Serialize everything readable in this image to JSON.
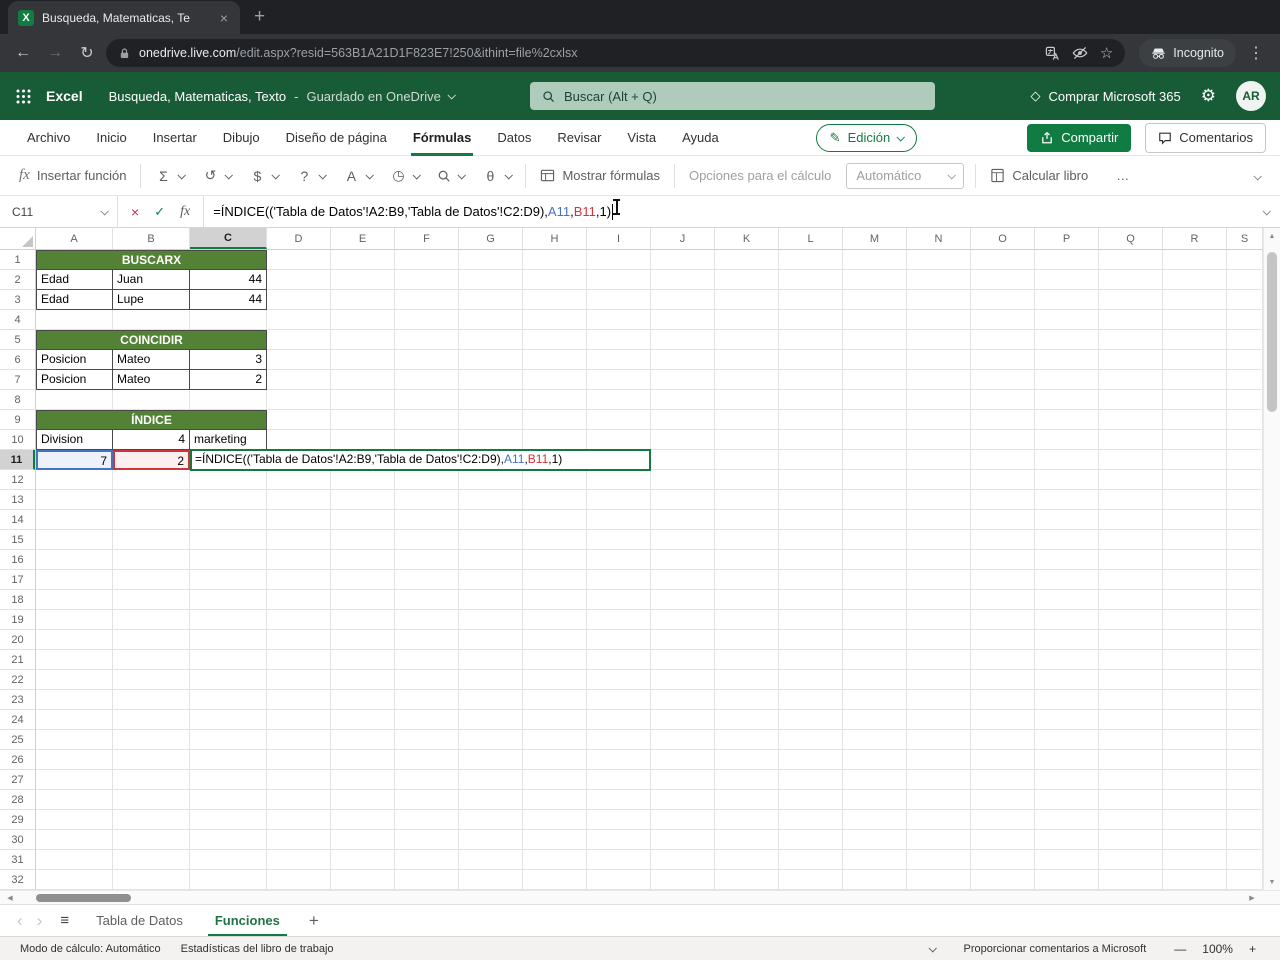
{
  "browser": {
    "tab": {
      "title": "Busqueda, Matematicas, Te"
    },
    "address": {
      "url_domain": "onedrive.live.com",
      "url_path": "/edit.aspx?resid=563B1A21D1F823E7!250&ithint=file%2cxlsx"
    },
    "incognito_label": "Incognito"
  },
  "suite_header": {
    "app_name": "Excel",
    "doc_title": "Busqueda, Matematicas, Texto",
    "title_separator": "-",
    "save_status": "Guardado en OneDrive",
    "search_placeholder": "Buscar (Alt + Q)",
    "upgrade_label": "Comprar Microsoft 365",
    "avatar_initials": "AR"
  },
  "ribbon": {
    "tabs": [
      "Archivo",
      "Inicio",
      "Insertar",
      "Dibujo",
      "Diseño de página",
      "Fórmulas",
      "Datos",
      "Revisar",
      "Vista",
      "Ayuda"
    ],
    "active_tab": "Fórmulas",
    "mode_button": "Edición",
    "share_button": "Compartir",
    "comments_button": "Comentarios",
    "toolbar": {
      "insert_function": "Insertar función",
      "show_formulas": "Mostrar fórmulas",
      "calc_options": "Opciones para el cálculo",
      "calc_mode": "Automático",
      "calc_workbook": "Calcular libro",
      "overflow": "…"
    }
  },
  "formula_bar": {
    "name_box": "C11",
    "formula": {
      "prefix": "=ÍNDICE(('Tabla de Datos'!A2:B9,'Tabla de Datos'!C2:D9),",
      "ref1": "A11",
      "sep1": ",",
      "ref2": "B11",
      "suffix": ",1)"
    }
  },
  "grid": {
    "columns": [
      "A",
      "B",
      "C",
      "D",
      "E",
      "F",
      "G",
      "H",
      "I",
      "J",
      "K",
      "L",
      "M",
      "N",
      "O",
      "P",
      "Q",
      "R",
      "S"
    ],
    "row_count": 32,
    "active_cell": "C11",
    "active_column": "C",
    "active_row": 11
  },
  "sheet": {
    "cells": [
      {
        "r": 1,
        "c": "A",
        "span": 3,
        "v": "BUSCARX",
        "kind": "header"
      },
      {
        "r": 2,
        "c": "A",
        "v": "Edad",
        "kind": "text"
      },
      {
        "r": 2,
        "c": "B",
        "v": "Juan",
        "kind": "text"
      },
      {
        "r": 2,
        "c": "C",
        "v": "44",
        "kind": "number"
      },
      {
        "r": 3,
        "c": "A",
        "v": "Edad",
        "kind": "text"
      },
      {
        "r": 3,
        "c": "B",
        "v": "Lupe",
        "kind": "text"
      },
      {
        "r": 3,
        "c": "C",
        "v": "44",
        "kind": "number"
      },
      {
        "r": 5,
        "c": "A",
        "span": 3,
        "v": "COINCIDIR",
        "kind": "header"
      },
      {
        "r": 6,
        "c": "A",
        "v": "Posicion",
        "kind": "text"
      },
      {
        "r": 6,
        "c": "B",
        "v": "Mateo",
        "kind": "text"
      },
      {
        "r": 6,
        "c": "C",
        "v": "3",
        "kind": "number"
      },
      {
        "r": 7,
        "c": "A",
        "v": "Posicion",
        "kind": "text"
      },
      {
        "r": 7,
        "c": "B",
        "v": "Mateo",
        "kind": "text"
      },
      {
        "r": 7,
        "c": "C",
        "v": "2",
        "kind": "number"
      },
      {
        "r": 9,
        "c": "A",
        "span": 3,
        "v": "ÍNDICE",
        "kind": "header"
      },
      {
        "r": 10,
        "c": "A",
        "v": "Division",
        "kind": "text"
      },
      {
        "r": 10,
        "c": "B",
        "v": "4",
        "kind": "number"
      },
      {
        "r": 10,
        "c": "C",
        "v": "marketing",
        "kind": "text"
      },
      {
        "r": 11,
        "c": "A",
        "v": "7",
        "kind": "number",
        "selection": "blue"
      },
      {
        "r": 11,
        "c": "B",
        "v": "2",
        "kind": "number",
        "selection": "red"
      }
    ],
    "edit_cell": {
      "ref": "C11",
      "end_column": "I"
    }
  },
  "sheet_tabs": {
    "tabs": [
      "Tabla de Datos",
      "Funciones"
    ],
    "active": "Funciones"
  },
  "status_bar": {
    "calc_mode": "Modo de cálculo: Automático",
    "workbook_stats": "Estadísticas del libro de trabajo",
    "feedback": "Proporcionar comentarios a Microsoft",
    "zoom_out": "—",
    "zoom_level": "100%",
    "zoom_in": "+"
  },
  "icons": {
    "excel_logo": "X",
    "close": "×",
    "new_tab": "+",
    "back": "←",
    "forward": "→",
    "reload": "↻",
    "star": "☆",
    "kebab": "⋮",
    "gear": "⚙",
    "diamond": "◇",
    "pencil": "✎",
    "sigma": "Σ",
    "recent_fn": "↺",
    "financial_fn": "$",
    "logical_fn": "?",
    "text_fn": "A",
    "datetime_fn": "◷",
    "math_fn": "θ",
    "cancel": "×",
    "confirm": "✓",
    "hamburger": "≡",
    "prev_sheet": "‹",
    "next_sheet": "›",
    "scroll_up": "▲",
    "scroll_down": "▼",
    "scroll_left": "◀",
    "scroll_right": "▶"
  },
  "colors": {
    "suite_green": "#185C37",
    "accent_green": "#107C41",
    "table_header_green": "#538135",
    "ref_blue": "#4472C4",
    "ref_red": "#D13438"
  }
}
